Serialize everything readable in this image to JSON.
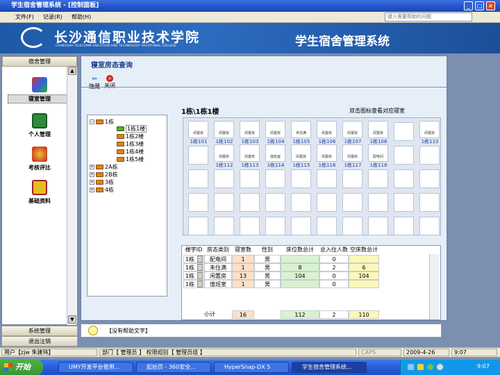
{
  "window": {
    "title": "学生宿舍管理系统 - [控制面板]"
  },
  "menu": {
    "items": [
      "文件(F)",
      "记录(R)",
      "帮助(H)"
    ],
    "help_placeholder": "键入需要帮助的问题"
  },
  "banner": {
    "school_cn": "长沙通信职业技术学院",
    "school_en": "CHANGSHA TELECOMM UNICATION AND TECHNOLOGY VOCATIONAL COLLEGE",
    "system_title": "学生宿舍管理系统"
  },
  "sidebar": {
    "header": "宿舍管理",
    "items": [
      "寝室管理",
      "个人管理",
      "考核评比",
      "基础资料"
    ],
    "footer": [
      "系统管理",
      "退出注销"
    ]
  },
  "main": {
    "title": "寝室房态查询",
    "toolbar": {
      "hide": "隐藏",
      "close": "关闭"
    },
    "path": "1栋\\1栋1楼",
    "hint": "双击图标查看对应寝室",
    "tree": {
      "root": "1栋",
      "floors": [
        "1栋1楼",
        "1栋2楼",
        "1栋3楼",
        "1栋4楼",
        "1栋5楼"
      ],
      "others": [
        "2A栋",
        "2B栋",
        "3栋",
        "4栋"
      ]
    },
    "rooms": [
      {
        "label": "1栋101",
        "tag": "闲置房"
      },
      {
        "label": "1栋102",
        "tag": "闲置房"
      },
      {
        "label": "1栋103",
        "tag": "闲置房"
      },
      {
        "label": "1栋104",
        "tag": "闲置房"
      },
      {
        "label": "1栋105",
        "tag": "未住满"
      },
      {
        "label": "1栋106",
        "tag": "闲置房"
      },
      {
        "label": "1栋107",
        "tag": "闲置房"
      },
      {
        "label": "1栋108",
        "tag": "闲置房"
      },
      {
        "label": "1栋110",
        "tag": "闲置房"
      },
      {
        "label": "1栋112",
        "tag": "闲置房"
      },
      {
        "label": "1栋113",
        "tag": "闲置房"
      },
      {
        "label": "1栋114",
        "tag": "值班室"
      },
      {
        "label": "1栋115",
        "tag": "闲置房"
      },
      {
        "label": "1栋116",
        "tag": "闲置房"
      },
      {
        "label": "1栋117",
        "tag": "闲置房"
      },
      {
        "label": "1栋118",
        "tag": "配电间"
      }
    ],
    "table": {
      "headers": [
        "楼宇ID",
        "房态类别",
        "寝室数",
        "性别",
        "床位数总计",
        "总入住人数",
        "空床数总计"
      ],
      "rows": [
        [
          "1栋",
          "配电间",
          "1",
          "男",
          "",
          "0",
          ""
        ],
        [
          "1栋",
          "未住满",
          "1",
          "男",
          "8",
          "2",
          "6"
        ],
        [
          "1栋",
          "闲置房",
          "13",
          "男",
          "104",
          "0",
          "104"
        ],
        [
          "1栋",
          "值班室",
          "1",
          "男",
          "",
          "0",
          ""
        ]
      ],
      "subtotal_label": "小计",
      "subtotal": [
        "16",
        "112",
        "2",
        "110"
      ]
    },
    "status_text": "【没有帮助文字】"
  },
  "statusbar": {
    "user": "用户【zjw 朱建玮】",
    "dept": "部门【 管理员 】 权限组别【 管理员组 】",
    "caps": "CAPS",
    "date": "2009-4-26",
    "time_short": "9:07"
  },
  "taskbar": {
    "start": "开始",
    "tasks": [
      "UMY开发平台使用...",
      "起始页 - 360安全...",
      "HyperSnap-DX 5",
      "学生宿舍管理系统..."
    ],
    "clock": "9:07"
  }
}
